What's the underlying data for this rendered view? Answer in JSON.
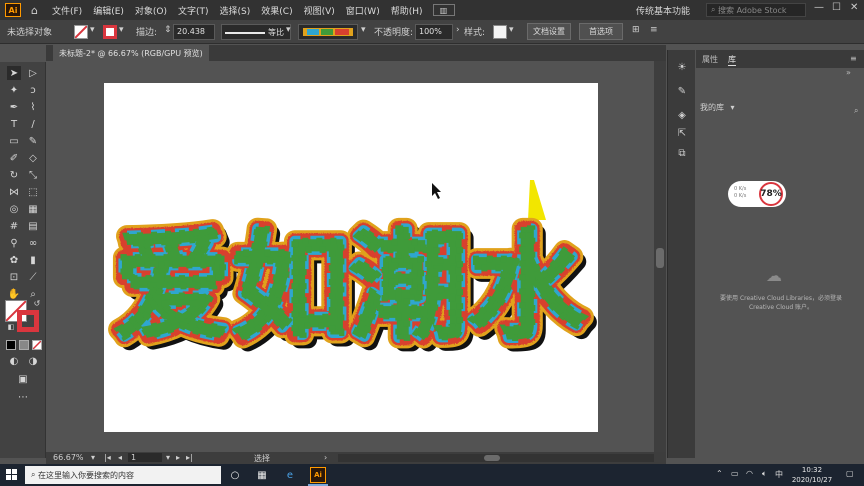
{
  "menubar": {
    "logo": "Ai",
    "home_icon": "home-icon",
    "menus": [
      "文件(F)",
      "编辑(E)",
      "对象(O)",
      "文字(T)",
      "选择(S)",
      "效果(C)",
      "视图(V)",
      "窗口(W)",
      "帮助(H)"
    ],
    "workspace_label": "传统基本功能",
    "search_placeholder": "搜索 Adobe Stock",
    "window_controls": [
      "—",
      "☐",
      "✕"
    ]
  },
  "controlbar": {
    "selection_label": "未选择对象",
    "stroke_label": "描边:",
    "stroke_value": "20.438",
    "stroke_style_label": "等比",
    "opacity_label": "不透明度:",
    "opacity_value": "100%",
    "style_label": "样式:",
    "doc_setup_button": "文档设置",
    "prefs_button": "首选项"
  },
  "document": {
    "tab_title": "未标题-2* @ 66.67% (RGB/GPU 预览)",
    "artwork_text": "爱如潮水"
  },
  "statusbar": {
    "zoom": "66.67%",
    "artboard_number": "1",
    "tool_status": "选择"
  },
  "panel": {
    "tabs": [
      "属性",
      "库"
    ],
    "library_select": "我的库",
    "popup_lines": [
      "0 K/s",
      "0 K/s"
    ],
    "popup_badge": "78%",
    "cc_message": "要使用 Creative Cloud Libraries，必须登录 Creative Cloud 账户。"
  },
  "taskbar": {
    "search_placeholder": "在这里输入你要搜索的内容",
    "clock_time": "10:32",
    "clock_date": "2020/10/27",
    "ime": "中"
  },
  "colors": {
    "accent_ai": "#ff9a00",
    "stroke_red": "#d9363e",
    "artwork_orange": "#e0a21c",
    "artwork_red": "#d8402f",
    "artwork_green": "#3f9b3a",
    "artwork_cyan": "#2fa6cf",
    "artwork_yellow": "#f2e600"
  }
}
